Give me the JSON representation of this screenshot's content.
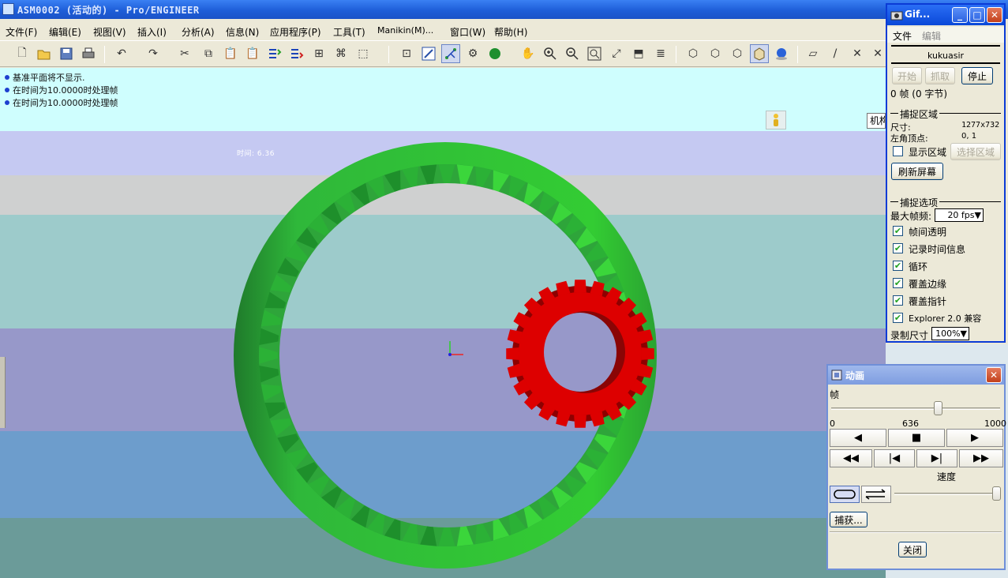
{
  "window": {
    "title": "ASM0002 (活动的) - Pro/ENGINEER"
  },
  "menu": [
    {
      "label": "文件(F)"
    },
    {
      "label": "编辑(E)"
    },
    {
      "label": "视图(V)"
    },
    {
      "label": "插入(I)"
    },
    {
      "label": "分析(A)"
    },
    {
      "label": "信息(N)"
    },
    {
      "label": "应用程序(P)"
    },
    {
      "label": "工具(T)"
    },
    {
      "label": "Manikin(M)..."
    },
    {
      "label": "窗口(W)"
    },
    {
      "label": "帮助(H)"
    }
  ],
  "toolbar": {
    "icons": [
      "new-icon",
      "open-icon",
      "save-icon",
      "print-icon",
      "undo-icon",
      "redo-icon",
      "cut-icon",
      "copy-icon",
      "paste-icon",
      "paste-special-icon",
      "regenerate-icon",
      "regen-manager-icon",
      "find-icon",
      "binoculars-icon",
      "select-box-icon",
      "model-tree-icon",
      "sketch-icon",
      "datum-display-icon",
      "spin-center-icon",
      "sphere-icon",
      "pan-icon",
      "zoom-in-icon",
      "zoom-out-icon",
      "refit-icon",
      "reorient-icon",
      "named-view-icon",
      "layers-icon",
      "wireframe-icon",
      "hidden-line-icon",
      "no-hidden-icon",
      "shading-icon",
      "appearance-icon",
      "datum-plane-icon",
      "datum-axis-icon",
      "datum-point-icon",
      "coord-sys-icon"
    ]
  },
  "messages": [
    "基准平面将不显示.",
    "在时间为10.0000时处理帧",
    "在时间为10.0000时处理帧"
  ],
  "viewport": {
    "time_label": "时间: 6.36",
    "model_tab": "机构"
  },
  "colors": {
    "ring_gear": "#33cc33",
    "ring_gear_dark": "#1f8a2b",
    "pinion_gear": "#dd0000",
    "pinion_gear_dark": "#8e0000",
    "titlebar": "#1e5ed8"
  },
  "gif_dialog": {
    "title": "Gif...",
    "menu": [
      "文件",
      "编辑"
    ],
    "name": "kukuasir",
    "buttons": {
      "start": "开始",
      "grab": "抓取",
      "stop": "停止"
    },
    "frame_info": "0 帧 (0 字节)",
    "capture_area": {
      "heading": "捕捉区域",
      "size_label": "尺寸:",
      "size_value": "1277x732",
      "origin_label": "左角顶点:",
      "origin_value": "0, 1",
      "show_area_label": "显示区域",
      "show_area_checked": false,
      "select_area_button": "选择区域",
      "refresh_button": "刷新屏幕"
    },
    "capture_options": {
      "heading": "捕捉选项",
      "max_fps_label": "最大帧频:",
      "max_fps_value": "20 fps",
      "options": [
        {
          "label": "帧间透明",
          "checked": true
        },
        {
          "label": "记录时间信息",
          "checked": true
        },
        {
          "label": "循环",
          "checked": true
        },
        {
          "label": "覆盖边缘",
          "checked": true
        },
        {
          "label": "覆盖指针",
          "checked": true
        },
        {
          "label": "Explorer 2.0 兼容",
          "checked": true
        }
      ],
      "record_size_label": "录制尺寸",
      "record_size_value": "100%"
    }
  },
  "animation_dialog": {
    "title": "动画",
    "frame_label": "帧",
    "frame_min": "0",
    "frame_current": "636",
    "frame_max": "1000",
    "frame_value": 636,
    "speed_label": "速度",
    "capture_button": "捕获...",
    "close_button": "关闭"
  }
}
